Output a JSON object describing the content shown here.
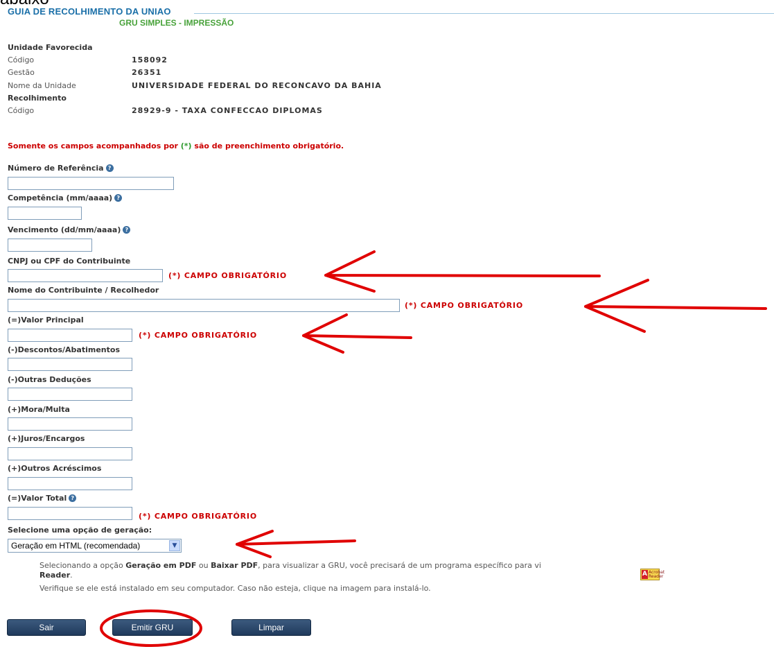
{
  "header": {
    "top_word": "abaixo",
    "title": "GUIA DE RECOLHIMENTO DA UNIAO",
    "subtitle": "GRU SIMPLES - IMPRESSÃO"
  },
  "unidade": {
    "section_label": "Unidade Favorecida",
    "codigo_label": "Código",
    "codigo_value": "158092",
    "gestao_label": "Gestão",
    "gestao_value": "26351",
    "nome_label": "Nome da Unidade",
    "nome_value": "UNIVERSIDADE FEDERAL DO RECONCAVO DA BAHIA"
  },
  "recolhimento": {
    "section_label": "Recolhimento",
    "codigo_label": "Código",
    "codigo_value": "28929-9 - TAXA CONFECCAO DIPLOMAS"
  },
  "notice": {
    "before": "Somente os campos acompanhados por ",
    "star": "(*)",
    "after": " são de preenchimento obrigatório."
  },
  "required_text": "(*) CAMPO OBRIGATÓRIO",
  "help_icon": "question-icon",
  "fields": {
    "referencia": {
      "label": "Número de Referência",
      "value": ""
    },
    "competencia": {
      "label": "Competência (mm/aaaa)",
      "value": ""
    },
    "vencimento": {
      "label": "Vencimento (dd/mm/aaaa)",
      "value": ""
    },
    "cnpj": {
      "label": "CNPJ ou CPF do Contribuinte",
      "value": ""
    },
    "nome": {
      "label": "Nome do Contribuinte / Recolhedor",
      "value": ""
    },
    "valor_principal": {
      "label": "(=)Valor Principal",
      "value": ""
    },
    "descontos": {
      "label": "(-)Descontos/Abatimentos",
      "value": ""
    },
    "outras_deducoes": {
      "label": "(-)Outras Deduções",
      "value": ""
    },
    "mora": {
      "label": "(+)Mora/Multa",
      "value": ""
    },
    "juros": {
      "label": "(+)Juros/Encargos",
      "value": ""
    },
    "outros_acrescimos": {
      "label": "(+)Outros Acréscimos",
      "value": ""
    },
    "valor_total": {
      "label": "(=)Valor Total",
      "value": ""
    }
  },
  "geracao": {
    "label": "Selecione uma opção de geração:",
    "selected": "Geração em HTML (recomendada)"
  },
  "info": {
    "line1_a": "Selecionando a opção ",
    "line1_b": "Geração em PDF",
    "line1_c": " ou ",
    "line1_d": "Baixar PDF",
    "line1_e": ", para visualizar a GRU, você precisará de um programa específico para vi",
    "line2": "Reader",
    "line2_end": ".",
    "line3": "Verifique se ele está instalado em seu computador. Caso não esteja, clique na imagem para instalá-lo."
  },
  "acrobat": {
    "icon": "acrobat-reader-icon",
    "text": "Acrobat Reader"
  },
  "buttons": {
    "sair": "Sair",
    "emitir": "Emitir GRU",
    "limpar": "Limpar"
  },
  "annotation_color": "#e00000"
}
